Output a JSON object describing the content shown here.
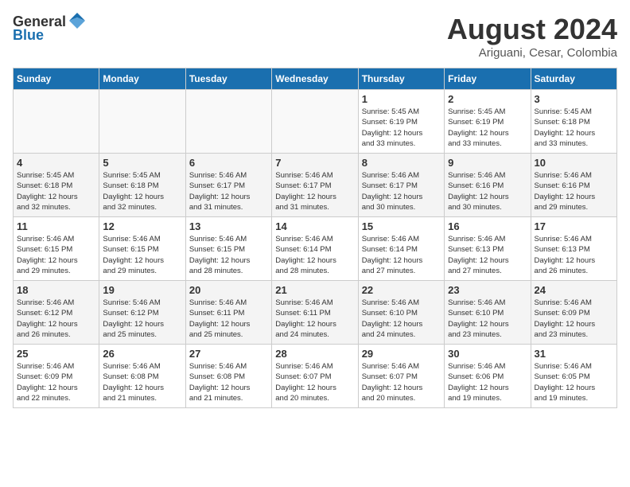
{
  "header": {
    "logo_general": "General",
    "logo_blue": "Blue",
    "month_year": "August 2024",
    "location": "Ariguani, Cesar, Colombia"
  },
  "weekdays": [
    "Sunday",
    "Monday",
    "Tuesday",
    "Wednesday",
    "Thursday",
    "Friday",
    "Saturday"
  ],
  "weeks": [
    [
      {
        "day": "",
        "info": ""
      },
      {
        "day": "",
        "info": ""
      },
      {
        "day": "",
        "info": ""
      },
      {
        "day": "",
        "info": ""
      },
      {
        "day": "1",
        "info": "Sunrise: 5:45 AM\nSunset: 6:19 PM\nDaylight: 12 hours\nand 33 minutes."
      },
      {
        "day": "2",
        "info": "Sunrise: 5:45 AM\nSunset: 6:19 PM\nDaylight: 12 hours\nand 33 minutes."
      },
      {
        "day": "3",
        "info": "Sunrise: 5:45 AM\nSunset: 6:18 PM\nDaylight: 12 hours\nand 33 minutes."
      }
    ],
    [
      {
        "day": "4",
        "info": "Sunrise: 5:45 AM\nSunset: 6:18 PM\nDaylight: 12 hours\nand 32 minutes."
      },
      {
        "day": "5",
        "info": "Sunrise: 5:45 AM\nSunset: 6:18 PM\nDaylight: 12 hours\nand 32 minutes."
      },
      {
        "day": "6",
        "info": "Sunrise: 5:46 AM\nSunset: 6:17 PM\nDaylight: 12 hours\nand 31 minutes."
      },
      {
        "day": "7",
        "info": "Sunrise: 5:46 AM\nSunset: 6:17 PM\nDaylight: 12 hours\nand 31 minutes."
      },
      {
        "day": "8",
        "info": "Sunrise: 5:46 AM\nSunset: 6:17 PM\nDaylight: 12 hours\nand 30 minutes."
      },
      {
        "day": "9",
        "info": "Sunrise: 5:46 AM\nSunset: 6:16 PM\nDaylight: 12 hours\nand 30 minutes."
      },
      {
        "day": "10",
        "info": "Sunrise: 5:46 AM\nSunset: 6:16 PM\nDaylight: 12 hours\nand 29 minutes."
      }
    ],
    [
      {
        "day": "11",
        "info": "Sunrise: 5:46 AM\nSunset: 6:15 PM\nDaylight: 12 hours\nand 29 minutes."
      },
      {
        "day": "12",
        "info": "Sunrise: 5:46 AM\nSunset: 6:15 PM\nDaylight: 12 hours\nand 29 minutes."
      },
      {
        "day": "13",
        "info": "Sunrise: 5:46 AM\nSunset: 6:15 PM\nDaylight: 12 hours\nand 28 minutes."
      },
      {
        "day": "14",
        "info": "Sunrise: 5:46 AM\nSunset: 6:14 PM\nDaylight: 12 hours\nand 28 minutes."
      },
      {
        "day": "15",
        "info": "Sunrise: 5:46 AM\nSunset: 6:14 PM\nDaylight: 12 hours\nand 27 minutes."
      },
      {
        "day": "16",
        "info": "Sunrise: 5:46 AM\nSunset: 6:13 PM\nDaylight: 12 hours\nand 27 minutes."
      },
      {
        "day": "17",
        "info": "Sunrise: 5:46 AM\nSunset: 6:13 PM\nDaylight: 12 hours\nand 26 minutes."
      }
    ],
    [
      {
        "day": "18",
        "info": "Sunrise: 5:46 AM\nSunset: 6:12 PM\nDaylight: 12 hours\nand 26 minutes."
      },
      {
        "day": "19",
        "info": "Sunrise: 5:46 AM\nSunset: 6:12 PM\nDaylight: 12 hours\nand 25 minutes."
      },
      {
        "day": "20",
        "info": "Sunrise: 5:46 AM\nSunset: 6:11 PM\nDaylight: 12 hours\nand 25 minutes."
      },
      {
        "day": "21",
        "info": "Sunrise: 5:46 AM\nSunset: 6:11 PM\nDaylight: 12 hours\nand 24 minutes."
      },
      {
        "day": "22",
        "info": "Sunrise: 5:46 AM\nSunset: 6:10 PM\nDaylight: 12 hours\nand 24 minutes."
      },
      {
        "day": "23",
        "info": "Sunrise: 5:46 AM\nSunset: 6:10 PM\nDaylight: 12 hours\nand 23 minutes."
      },
      {
        "day": "24",
        "info": "Sunrise: 5:46 AM\nSunset: 6:09 PM\nDaylight: 12 hours\nand 23 minutes."
      }
    ],
    [
      {
        "day": "25",
        "info": "Sunrise: 5:46 AM\nSunset: 6:09 PM\nDaylight: 12 hours\nand 22 minutes."
      },
      {
        "day": "26",
        "info": "Sunrise: 5:46 AM\nSunset: 6:08 PM\nDaylight: 12 hours\nand 21 minutes."
      },
      {
        "day": "27",
        "info": "Sunrise: 5:46 AM\nSunset: 6:08 PM\nDaylight: 12 hours\nand 21 minutes."
      },
      {
        "day": "28",
        "info": "Sunrise: 5:46 AM\nSunset: 6:07 PM\nDaylight: 12 hours\nand 20 minutes."
      },
      {
        "day": "29",
        "info": "Sunrise: 5:46 AM\nSunset: 6:07 PM\nDaylight: 12 hours\nand 20 minutes."
      },
      {
        "day": "30",
        "info": "Sunrise: 5:46 AM\nSunset: 6:06 PM\nDaylight: 12 hours\nand 19 minutes."
      },
      {
        "day": "31",
        "info": "Sunrise: 5:46 AM\nSunset: 6:05 PM\nDaylight: 12 hours\nand 19 minutes."
      }
    ]
  ]
}
